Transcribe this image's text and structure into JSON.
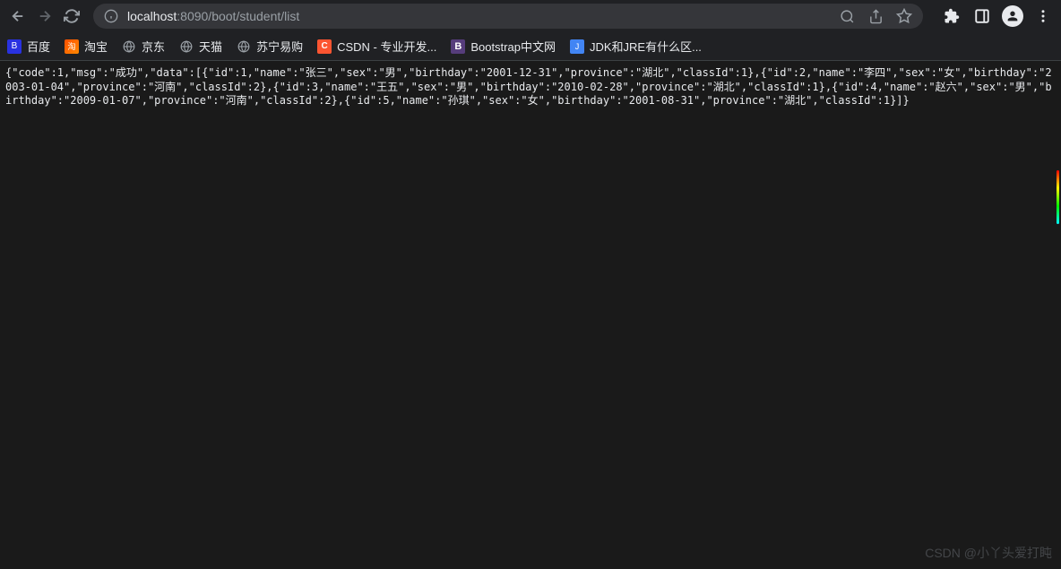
{
  "url": {
    "host": "localhost",
    "rest": ":8090/boot/student/list"
  },
  "bookmarks": [
    {
      "label": "百度",
      "icon": "baidu",
      "glyph": "B"
    },
    {
      "label": "淘宝",
      "icon": "taobao",
      "glyph": "淘"
    },
    {
      "label": "京东",
      "icon": "globe",
      "glyph": ""
    },
    {
      "label": "天猫",
      "icon": "globe",
      "glyph": ""
    },
    {
      "label": "苏宁易购",
      "icon": "globe",
      "glyph": ""
    },
    {
      "label": "CSDN - 专业开发...",
      "icon": "csdn",
      "glyph": "C"
    },
    {
      "label": "Bootstrap中文网",
      "icon": "bootstrap",
      "glyph": "B"
    },
    {
      "label": "JDK和JRE有什么区...",
      "icon": "jdk",
      "glyph": "J"
    }
  ],
  "json_response": "{\"code\":1,\"msg\":\"成功\",\"data\":[{\"id\":1,\"name\":\"张三\",\"sex\":\"男\",\"birthday\":\"2001-12-31\",\"province\":\"湖北\",\"classId\":1},{\"id\":2,\"name\":\"李四\",\"sex\":\"女\",\"birthday\":\"2003-01-04\",\"province\":\"河南\",\"classId\":2},{\"id\":3,\"name\":\"王五\",\"sex\":\"男\",\"birthday\":\"2010-02-28\",\"province\":\"湖北\",\"classId\":1},{\"id\":4,\"name\":\"赵六\",\"sex\":\"男\",\"birthday\":\"2009-01-07\",\"province\":\"河南\",\"classId\":2},{\"id\":5,\"name\":\"孙琪\",\"sex\":\"女\",\"birthday\":\"2001-08-31\",\"province\":\"湖北\",\"classId\":1}]}",
  "watermark": "CSDN @小丫头爱打盹"
}
